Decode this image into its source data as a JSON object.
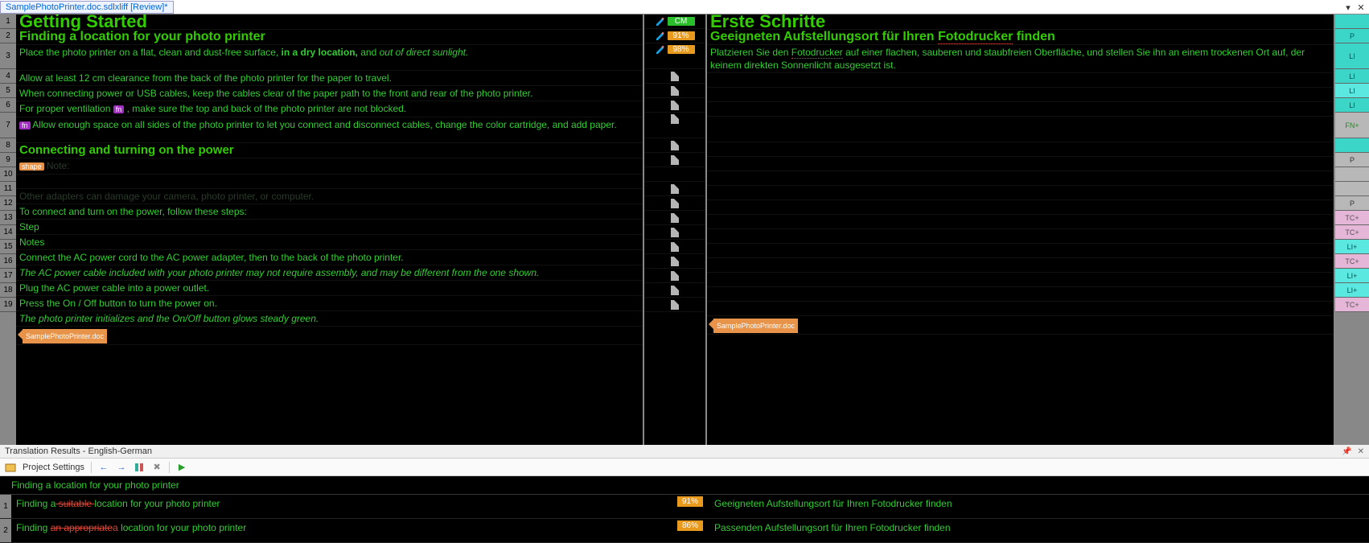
{
  "tab_title": "SamplePhotoPrinter.doc.sdlxliff [Review]*",
  "rows": [
    {
      "n": "1",
      "src_type": "h1",
      "src": "Getting Started",
      "mid": {
        "kind": "pencil_cm",
        "val": "CM"
      },
      "tgt_type": "h1",
      "tgt": "Erste Schritte",
      "stat": "",
      "stat_cls": "st-teal"
    },
    {
      "n": "2",
      "src_type": "h2",
      "src": "Finding a location for your photo printer",
      "mid": {
        "kind": "pencil_pct",
        "val": "91%"
      },
      "tgt_type": "h2",
      "tgt": "Geeigneten Aufstellungsort für Ihren Fotodrucker finden",
      "tgt_redunder": true,
      "stat": "P",
      "stat_cls": "st-teal"
    },
    {
      "n": "3",
      "src_type": "body",
      "src_html": "Place the photo printer on a flat, clean and dust-free surface, <span class='bold'>in a dry location,</span> and <span class='italic'>out of direct sunlight.</span>",
      "mid": {
        "kind": "pencil_pct",
        "val": "98%"
      },
      "tgt_type": "body",
      "tgt_html": "Platzieren Sie den <span class='redunder'>Fotodrucker</span> auf einer flachen, sauberen und staubfreien Oberfläche, und stellen Sie ihn an einem trockenen Ort auf, der keinem direkten Sonnenlicht ausgesetzt ist.",
      "stat": "LI",
      "stat_cls": "st-teal",
      "tall": true
    },
    {
      "n": "4",
      "src_type": "body",
      "src": "Allow at least 12 cm clearance from the back of the photo printer for the paper to travel.",
      "mid": {
        "kind": "doc"
      },
      "tgt": "",
      "stat": "LI",
      "stat_cls": "st-teal"
    },
    {
      "n": "5",
      "src_type": "body",
      "src": "When connecting power or USB cables, keep the cables clear of the paper path to the front and rear of the photo printer.",
      "mid": {
        "kind": "doc"
      },
      "tgt": "",
      "stat": "LI",
      "stat_cls": "st-cyan"
    },
    {
      "n": "6",
      "src_type": "body",
      "src_html": "For proper ventilation <span class='tag'>fn</span> , make sure the top and back of the photo printer are not blocked.",
      "mid": {
        "kind": "doc"
      },
      "tgt": "",
      "stat": "LI",
      "stat_cls": "st-teal"
    },
    {
      "n": "7",
      "src_type": "body",
      "src_html": "<span class='tag'>fn</span> Allow enough space on all sides of the photo printer to let you connect and disconnect cables, change the color cartridge, and add paper.",
      "mid": {
        "kind": "doc"
      },
      "tgt": "",
      "stat": "FN+",
      "stat_cls": "st-fn",
      "tall": true
    },
    {
      "n": "8",
      "src_type": "h3",
      "src": "Connecting and turning on the power",
      "mid": {
        "kind": "doc"
      },
      "tgt": "",
      "stat": "",
      "stat_cls": "st-teal"
    },
    {
      "n": "9",
      "src_type": "body",
      "src_html": "<span class='tag orange'>shape</span> <span class='dim'>Note:</span>",
      "mid": {
        "kind": "doc"
      },
      "tgt": "",
      "stat": "P",
      "stat_cls": "st-grey"
    },
    {
      "n": "10",
      "src_type": "body",
      "src": "",
      "mid": {
        "kind": "none"
      },
      "tgt": "",
      "stat": "",
      "stat_cls": "st-grey"
    },
    {
      "n": "11",
      "src_type": "body",
      "src_html": "<span class='dim'>Other adapters can damage your camera, photo printer, or computer.</span>",
      "mid": {
        "kind": "doc"
      },
      "tgt": "",
      "stat": "",
      "stat_cls": "st-grey"
    },
    {
      "n": "12",
      "src_type": "body",
      "src": "To connect and turn on the power, follow these steps:",
      "mid": {
        "kind": "doc"
      },
      "tgt": "",
      "stat": "P",
      "stat_cls": "st-grey"
    },
    {
      "n": "13",
      "src_type": "body",
      "src": "Step",
      "mid": {
        "kind": "doc"
      },
      "tgt": "",
      "stat": "TC+",
      "stat_cls": "st-pink"
    },
    {
      "n": "14",
      "src_type": "body",
      "src": "Notes",
      "mid": {
        "kind": "doc"
      },
      "tgt": "",
      "stat": "TC+",
      "stat_cls": "st-pink"
    },
    {
      "n": "15",
      "src_type": "body",
      "src": "Connect the AC power cord to the AC power adapter, then to the back of the photo printer.",
      "mid": {
        "kind": "doc"
      },
      "tgt": "",
      "stat": "LI+",
      "stat_cls": "st-cyan"
    },
    {
      "n": "16",
      "src_type": "body",
      "src_html": "<span class='italic'>The AC power cable included with your photo printer may not require assembly, and may be different from the one shown.</span>",
      "mid": {
        "kind": "doc"
      },
      "tgt": "",
      "stat": "TC+",
      "stat_cls": "st-pink"
    },
    {
      "n": "17",
      "src_type": "body",
      "src": "Plug the AC power cable into a power outlet.",
      "mid": {
        "kind": "doc"
      },
      "tgt": "",
      "stat": "LI+",
      "stat_cls": "st-cyan"
    },
    {
      "n": "18",
      "src_type": "body",
      "src": "Press the On / Off button to turn the power on.",
      "mid": {
        "kind": "doc"
      },
      "tgt": "",
      "stat": "LI+",
      "stat_cls": "st-cyan"
    },
    {
      "n": "19",
      "src_type": "body",
      "src_html": "<span class='italic'>The photo printer initializes and the On/Off button glows steady green.</span>",
      "mid": {
        "kind": "doc"
      },
      "tgt": "",
      "stat": "TC+",
      "stat_cls": "st-pink"
    }
  ],
  "end_tag_src": "SamplePhotoPrinter.doc",
  "end_tag_tgt": "SamplePhotoPrinter.doc",
  "tr_title": "Translation Results - English-German",
  "tr_toolbar": {
    "settings": "Project Settings"
  },
  "tr_query": "Finding a location for your photo printer",
  "tr_rows": [
    {
      "n": "1",
      "l_pre": "Finding a",
      "l_strike": " suitable ",
      "l_post": "location for your photo printer",
      "pct": "91%",
      "r": "Geeigneten Aufstellungsort für Ihren Fotodrucker finden"
    },
    {
      "n": "2",
      "l_pre": "Finding ",
      "l_strike": "an appropriate",
      "l_ins": "a",
      "l_post": " location for your photo printer",
      "pct": "86%",
      "r": "Passenden Aufstellungsort für Ihren Fotodrucker finden"
    }
  ]
}
